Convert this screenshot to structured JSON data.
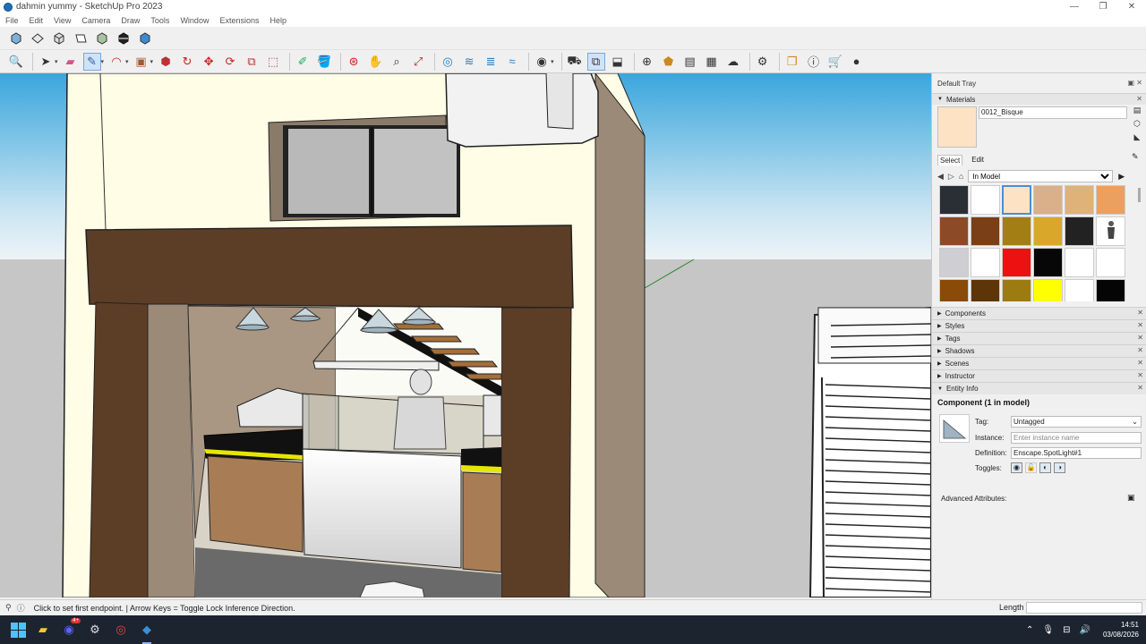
{
  "window": {
    "title": "dahmin yummy - SketchUp Pro 2023",
    "controls": [
      "—",
      "❐",
      "✕"
    ]
  },
  "menu": [
    "File",
    "Edit",
    "View",
    "Camera",
    "Draw",
    "Tools",
    "Window",
    "Extensions",
    "Help"
  ],
  "toolbar1_icons": [
    "iso-view-icon",
    "top-view-icon",
    "front-view-icon",
    "right-view-icon",
    "back-view-icon",
    "left-view-icon",
    "bottom-view-icon"
  ],
  "toolbar2_icons": [
    "zoom-icon",
    "select-icon",
    "eraser-icon",
    "pencil-icon",
    "arc-icon",
    "rectangle-icon",
    "push-pull-icon",
    "follow-me-icon",
    "move-icon",
    "rotate-icon",
    "scale-icon",
    "offset-icon",
    "tape-measure-icon",
    "paint-bucket-icon",
    "orbit-icon",
    "pan-icon",
    "zoom-window-icon",
    "zoom-extents-icon",
    "section-plane-icon",
    "display-section-icon",
    "section-cuts-icon",
    "section-fill-icon",
    "account-icon",
    "warehouse-icon",
    "extension-icon",
    "geo-icon",
    "layout-icon",
    "style-builder-icon",
    "trimble-connect-icon",
    "settings-icon",
    "folder-icon",
    "info-icon",
    "cart-icon",
    "profile-icon"
  ],
  "tray": {
    "title": "Default Tray",
    "materials": {
      "panel_label": "Materials",
      "current_name": "0012_Bisque",
      "current_color": "#fde3c4",
      "tabs": [
        "Select",
        "Edit"
      ],
      "active_tab": "Select",
      "collection": "In Model",
      "swatches": [
        "#2a2f36",
        "#ffffff",
        "#fde3c4",
        "#d9b089",
        "#dfb27a",
        "#eca05f",
        "#8c4a26",
        "#7a3f16",
        "#a37e14",
        "#d9a82a",
        "#222222",
        "person",
        "#cfcfd3",
        "#ffffff",
        "#ee1111",
        "#070707",
        "#ffffff",
        "#ffffff",
        "#8a4a08",
        "#5e3409",
        "#9c7c10",
        "#ffff00",
        "#ffffff",
        "#050505"
      ],
      "selected_index": 2
    },
    "panels": [
      "Components",
      "Styles",
      "Tags",
      "Shadows",
      "Scenes",
      "Instructor",
      "Entity Info"
    ],
    "entity_info": {
      "heading": "Component (1 in model)",
      "tag_label": "Tag:",
      "tag_value": "Untagged",
      "instance_label": "Instance:",
      "instance_placeholder": "Enter instance name",
      "definition_label": "Definition:",
      "definition_value": "Enscape.SpotLight#1",
      "toggles_label": "Toggles:",
      "advanced_label": "Advanced Attributes:"
    }
  },
  "status": {
    "message": "Click to set first endpoint. | Arrow Keys = Toggle Lock Inference Direction.",
    "length_label": "Length",
    "length_value": ""
  },
  "taskbar": {
    "apps": [
      "file-explorer-icon",
      "discord-icon",
      "steam-icon",
      "chrome-icon",
      "sketchup-icon"
    ],
    "discord_badge": "4+",
    "time": "14:51",
    "date": "03/08/2026"
  }
}
